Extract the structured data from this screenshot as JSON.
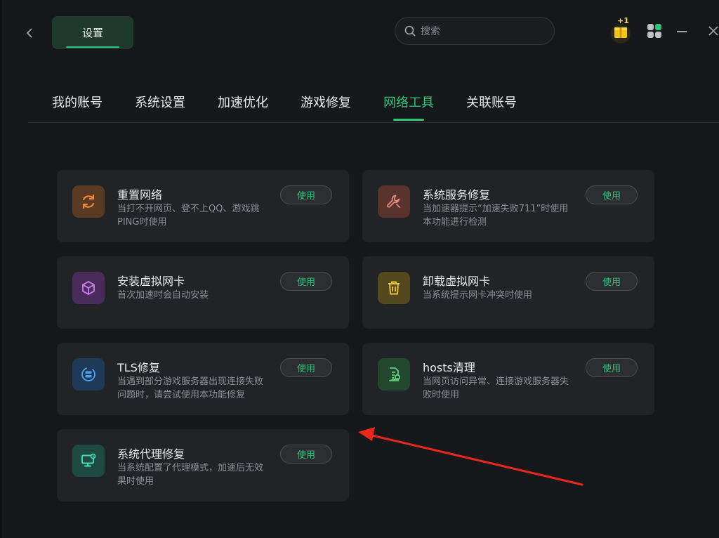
{
  "window": {
    "title": "设置",
    "search_placeholder": "搜索"
  },
  "badge": {
    "label": "+1"
  },
  "tabs": [
    {
      "label": "我的账号",
      "active": false
    },
    {
      "label": "系统设置",
      "active": false
    },
    {
      "label": "加速优化",
      "active": false
    },
    {
      "label": "游戏修复",
      "active": false
    },
    {
      "label": "网络工具",
      "active": true
    },
    {
      "label": "关联账号",
      "active": false
    }
  ],
  "tools": [
    {
      "title": "重置网络",
      "desc": "当打不开网页、登不上QQ、游戏跳PING时使用",
      "button": "使用",
      "icon": "refresh-icon",
      "color": "#e88a3c",
      "bg": "#5a3a22"
    },
    {
      "title": "系统服务修复",
      "desc": "当加速器提示“加速失败711”时使用本功能进行检测",
      "button": "使用",
      "icon": "wrench-icon",
      "color": "#e58a7c",
      "bg": "#5a332f"
    },
    {
      "title": "安装虚拟网卡",
      "desc": "首次加速时会自动安装",
      "button": "使用",
      "icon": "cube-icon",
      "color": "#c77bea",
      "bg": "#4a2c5c"
    },
    {
      "title": "卸载虚拟网卡",
      "desc": "当系统提示网卡冲突时使用",
      "button": "使用",
      "icon": "trash-icon",
      "color": "#e8c63a",
      "bg": "#54481f"
    },
    {
      "title": "TLS修复",
      "desc": "当遇到部分游戏服务器出现连接失败问题时，请尝试使用本功能修复",
      "button": "使用",
      "icon": "server-icon",
      "color": "#4ba3f0",
      "bg": "#1f3a58"
    },
    {
      "title": "hosts清理",
      "desc": "当网页访问异常、连接游戏服务器失败时使用",
      "button": "使用",
      "icon": "file-clean-icon",
      "color": "#5dd37a",
      "bg": "#24482e"
    },
    {
      "title": "系统代理修复",
      "desc": "当系统配置了代理模式，加速后无效果时使用",
      "button": "使用",
      "icon": "monitor-icon",
      "color": "#3fe0bf",
      "bg": "#1f4a42"
    }
  ]
}
